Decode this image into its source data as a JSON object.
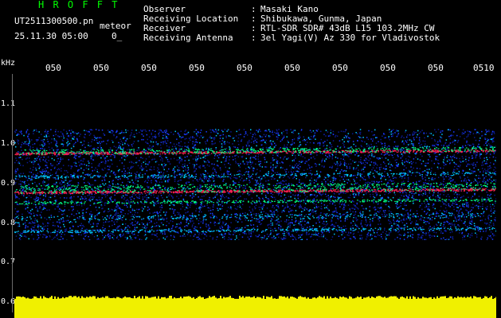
{
  "header": {
    "brand": "H R O F F T",
    "filename": "UT2511300500.pn",
    "type_label": "meteor",
    "datetime": "25.11.30 05:00",
    "value": "0_",
    "rows": [
      {
        "label": "Observer",
        "sep": ":",
        "value": "Masaki Kano"
      },
      {
        "label": "Receiving Location",
        "sep": ":",
        "value": "Shibukawa, Gunma, Japan"
      },
      {
        "label": "Receiver",
        "sep": ":",
        "value": "RTL-SDR SDR# 43dB L15 103.2MHz CW"
      },
      {
        "label": "Receiving Antenna",
        "sep": ":",
        "value": "3el Yagi(V) Az 330 for Vladivostok"
      }
    ]
  },
  "axis": {
    "unit": "kHz",
    "time_ticks": [
      "050",
      "050",
      "050",
      "050",
      "050",
      "050",
      "050",
      "050",
      "050",
      "0510"
    ],
    "freq_ticks": [
      "1.1",
      "1.0",
      "0.9",
      "0.8",
      "0.7",
      "0.6"
    ]
  },
  "colors": {
    "background": "#000000",
    "title": "#00ff00",
    "noise_low": "#1a3cff",
    "noise_mid": "#00c8ff",
    "band": "#00ff80",
    "line_peak": "#ff2050",
    "power_bar": "#f0f000"
  }
}
